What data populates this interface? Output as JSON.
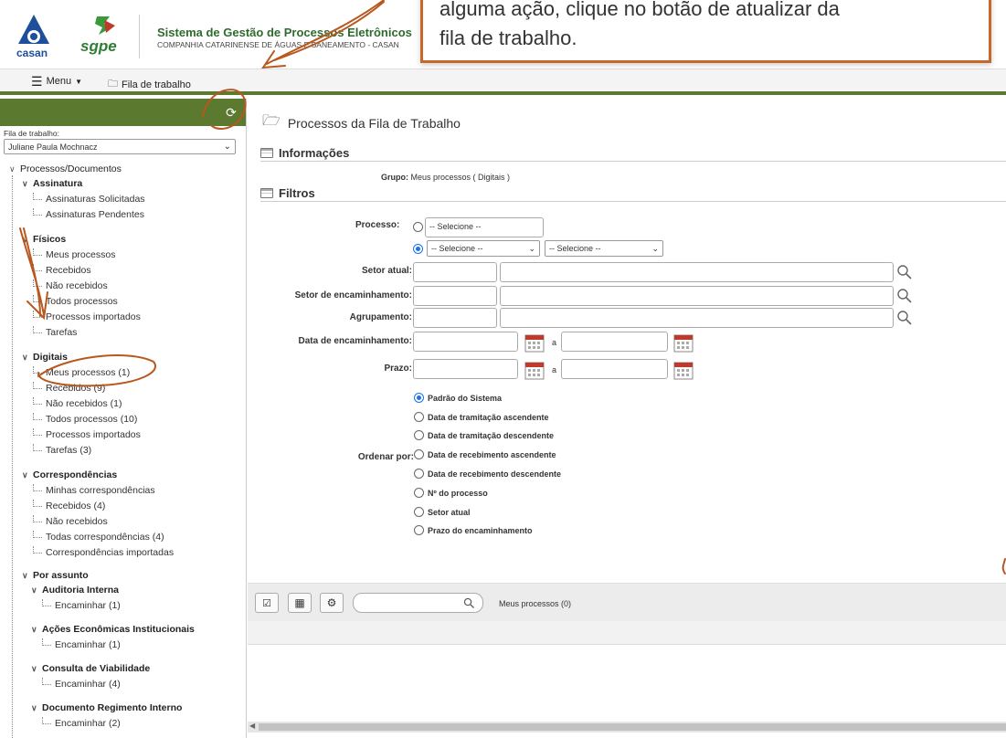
{
  "header": {
    "title": "Sistema de Gestão de Processos Eletrônicos",
    "company": "COMPANHIA CATARINENSE DE ÁGUAS E SANEAMENTO - CASAN",
    "casan_logo_text": "casan",
    "sgpe_logo_text": "sgpe"
  },
  "toolbar": {
    "menu_label": "Menu",
    "fila_label": "Fila de trabalho"
  },
  "tooltip": {
    "line1": "alguma ação, clique no botão de atualizar da",
    "line2": "fila de trabalho."
  },
  "sidebar": {
    "fila_label": "Fila de trabalho:",
    "fila_selected": "Juliane Paula Mochnacz",
    "root": "Processos/Documentos",
    "assinatura": {
      "label": "Assinatura",
      "items": [
        "Assinaturas Solicitadas",
        "Assinaturas Pendentes"
      ]
    },
    "fisicos": {
      "label": "Físicos",
      "items": [
        "Meus processos",
        "Recebidos",
        "Não recebidos",
        "Todos processos",
        "Processos importados",
        "Tarefas"
      ]
    },
    "digitais": {
      "label": "Digitais",
      "items": [
        "Meus processos (1)",
        "Recebidos (9)",
        "Não recebidos (1)",
        "Todos processos (10)",
        "Processos importados",
        "Tarefas (3)"
      ]
    },
    "correspondencias": {
      "label": "Correspondências",
      "items": [
        "Minhas correspondências",
        "Recebidos (4)",
        "Não recebidos",
        "Todas correspondências (4)",
        "Correspondências importadas"
      ]
    },
    "por_assunto": {
      "label": "Por assunto",
      "groups": [
        {
          "label": "Auditoria Interna",
          "item": "Encaminhar (1)"
        },
        {
          "label": "Ações Econômicas Institucionais",
          "item": "Encaminhar (1)"
        },
        {
          "label": "Consulta de Viabilidade",
          "item": "Encaminhar (4)"
        },
        {
          "label": "Documento Regimento Interno",
          "item": "Encaminhar (2)"
        }
      ]
    }
  },
  "main": {
    "title": "Processos da Fila de Trabalho",
    "info_section": "Informações",
    "grupo_label": "Grupo:",
    "grupo_value": "Meus processos  ( Digitais )",
    "filtros_section": "Filtros",
    "processo_label": "Processo:",
    "select_placeholder": "-- Selecione --",
    "setor_atual_label": "Setor atual:",
    "setor_enc_label": "Setor de encaminhamento:",
    "agrupamento_label": "Agrupamento:",
    "data_enc_label": "Data de encaminhamento:",
    "prazo_label": "Prazo:",
    "a_label": "a",
    "ordenar_label": "Ordenar por:",
    "order_options": [
      "Padrão do Sistema",
      "Data de tramitação ascendente",
      "Data de tramitação descendente",
      "Data de recebimento ascendente",
      "Data de recebimento descendente",
      "Nº do processo",
      "Setor atual",
      "Prazo do encaminhamento"
    ],
    "grid_count": "Meus processos (0)"
  },
  "colors": {
    "accent_green": "#5b7a2f",
    "annotation_orange": "#c8672a",
    "radio_blue": "#1a73e8"
  }
}
